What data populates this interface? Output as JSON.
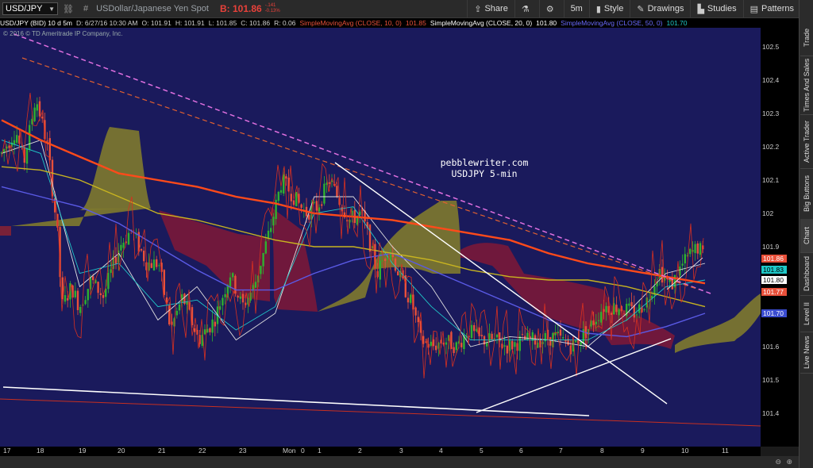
{
  "toolbar": {
    "symbol": "USD/JPY",
    "description": "USDollar/Japanese Yen Spot",
    "bid_label": "B: 101.86",
    "change_abs": "-.141",
    "change_pct": "-0.13%",
    "buttons": [
      {
        "label": "Share",
        "icon": "share-icon"
      },
      {
        "label": "",
        "icon": "flask-icon"
      },
      {
        "label": "",
        "icon": "gear-icon"
      },
      {
        "label": "5m",
        "icon": ""
      },
      {
        "label": "Style",
        "icon": "candles-icon"
      },
      {
        "label": "Drawings",
        "icon": "pencil-icon"
      },
      {
        "label": "Studies",
        "icon": "studies-icon"
      },
      {
        "label": "Patterns",
        "icon": "patterns-icon"
      }
    ]
  },
  "infobar": {
    "symbol": "USD/JPY (BID) 10 d 5m",
    "date": "D: 6/27/16 10:30 AM",
    "open": "O: 101.91",
    "high": "H: 101.91",
    "low": "L: 101.85",
    "close": "C: 101.86",
    "range": "R: 0.06",
    "sma10": "SimpleMovingAvg (CLOSE, 10, 0)",
    "sma10_val": "101.85",
    "sma20": "SimpleMovingAvg (CLOSE, 20, 0)",
    "sma20_val": "101.80",
    "sma50": "SimpleMovingAvg (CLOSE, 50, 0)",
    "sma50_val": "101.70"
  },
  "copyright": "© 2016 © TD Ameritrade IP Company, Inc.",
  "watermark": {
    "line1": "pebblewriter.com",
    "line2": "USDJPY 5-min"
  },
  "right_tabs": [
    "Trade",
    "Times And Sales",
    "Active Trader",
    "Big Buttons",
    "Chart",
    "Dashboard",
    "Level II",
    "Live News"
  ],
  "price_badges": [
    {
      "value": "101.86",
      "color": "#e8503a"
    },
    {
      "value": "101.83",
      "color": "#1ec8c8"
    },
    {
      "value": "101.80",
      "color": "#ffffff"
    },
    {
      "value": "101.77",
      "color": "#e8503a"
    },
    {
      "value": "101.70",
      "color": "#3a4cd0"
    }
  ],
  "colors": {
    "background": "#1a1a5c",
    "up_candle": "#2fb02f",
    "down_candle": "#e8503a",
    "sma10": "#e0e0e0",
    "sma20": "#20c8c8",
    "sma50": "#5a5ae6",
    "sma200": "#ff4a1a",
    "sma100": "#c8b420",
    "cloud_bull": "#807a2e",
    "cloud_bear": "#7a1838",
    "trendline_pink": "#e070e0",
    "trendline_orange": "#e06030"
  },
  "chart_data": {
    "type": "line",
    "title": "",
    "xlabel": "",
    "ylabel": "",
    "ylim": [
      101.35,
      102.6
    ],
    "y_ticks": [
      "102.5",
      "102.4",
      "102.3",
      "102.2",
      "102.1",
      "102",
      "101.9",
      "101.8",
      "101.7",
      "101.6",
      "101.5",
      "101.4"
    ],
    "x_ticks": [
      "17",
      "18",
      "19",
      "20",
      "21",
      "22",
      "23",
      "Mon",
      "0",
      "1",
      "2",
      "3",
      "4",
      "5",
      "6",
      "7",
      "8",
      "9",
      "10",
      "11"
    ],
    "series": [
      {
        "name": "SimpleMovingAvg (CLOSE, 10, 0)",
        "values": [
          102.18,
          102.22,
          101.78,
          101.88,
          101.68,
          101.78,
          101.62,
          101.7,
          102.05,
          102.05,
          101.9,
          101.78,
          101.6,
          101.63,
          101.62,
          101.6,
          101.7,
          101.82,
          101.85
        ]
      },
      {
        "name": "SimpleMovingAvg (CLOSE, 20, 0)",
        "values": [
          102.22,
          102.18,
          101.82,
          101.85,
          101.72,
          101.74,
          101.65,
          101.72,
          102.0,
          102.02,
          101.85,
          101.72,
          101.62,
          101.62,
          101.62,
          101.62,
          101.68,
          101.78,
          101.8
        ]
      },
      {
        "name": "SimpleMovingAvg (CLOSE, 50, 0)",
        "values": [
          102.08,
          102.05,
          102.02,
          101.97,
          101.9,
          101.83,
          101.77,
          101.77,
          101.82,
          101.86,
          101.88,
          101.83,
          101.78,
          101.73,
          101.68,
          101.64,
          101.63,
          101.66,
          101.7
        ]
      }
    ]
  }
}
